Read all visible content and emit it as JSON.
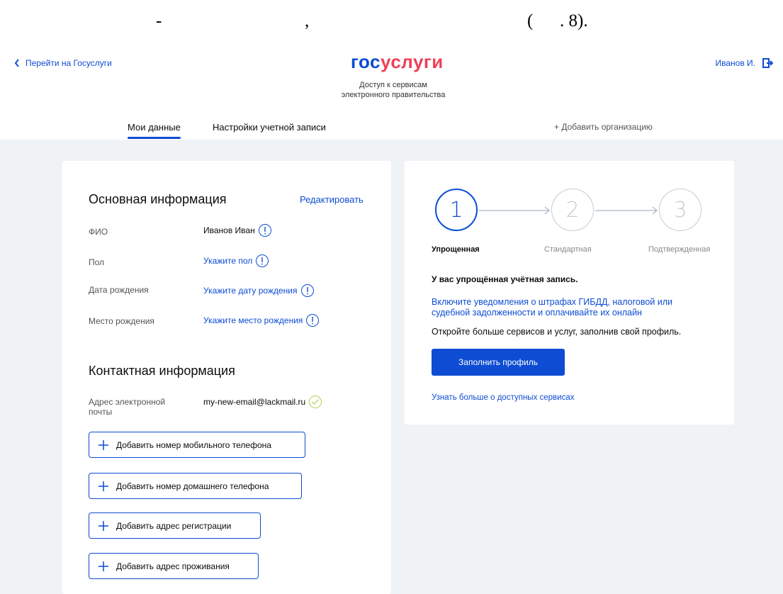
{
  "caption": {
    "dash": "-",
    "comma": ",",
    "open_paren": "(",
    "fig_ref": ". 8)."
  },
  "header": {
    "back_link": "Перейти на Госуслуги",
    "logo_gos": "гос",
    "logo_uslugi": "услуги",
    "tagline_line1": "Доступ к сервисам",
    "tagline_line2": "электронного правительства",
    "user_name": "Иванов И."
  },
  "tabs": {
    "my_data": "Мои данные",
    "account_settings": "Настройки учетной записи",
    "add_org": "+ Добавить организацию"
  },
  "basic_info": {
    "title": "Основная информация",
    "edit": "Редактировать",
    "rows": [
      {
        "label": "ФИО",
        "value": "Иванов Иван"
      },
      {
        "label": "Пол",
        "value": "Укажите пол"
      },
      {
        "label": "Дата рождения",
        "value": "Укажите дату рождения"
      },
      {
        "label": "Место рождения",
        "value": "Укажите место рождения"
      }
    ]
  },
  "contact_info": {
    "title": "Контактная информация",
    "email_label_line1": "Адрес электронной",
    "email_label_line2": "почты",
    "email_value": "my-new-email@lackmail.ru",
    "buttons": {
      "mobile": "Добавить номер мобильного телефона",
      "home": "Добавить номер домашнего телефона",
      "registration": "Добавить адрес регистрации",
      "residence": "Добавить адрес проживания"
    }
  },
  "account_level": {
    "steps": [
      {
        "number": "1",
        "label": "Упрощенная"
      },
      {
        "number": "2",
        "label": "Стандартная"
      },
      {
        "number": "3",
        "label": "Подтвержденная"
      }
    ],
    "status": "У вас упрощённая учётная запись.",
    "notify_line1": "Включите уведомления о штрафах ГИБДД, налоговой или",
    "notify_line2": "судебной задолженности и оплачивайте их онлайн",
    "open_more": "Откройте больше сервисов и услуг, заполнив свой профиль.",
    "fill_button": "Заполнить профиль",
    "more_link": "Узнать больше о доступных сервисах"
  },
  "colors": {
    "primary": "#0d4cd3",
    "logo_red": "#ee3f58",
    "success": "#b8d86d",
    "background": "#f0f3f6"
  },
  "icons": [
    "chevron-left-icon",
    "logout-icon",
    "info-icon",
    "check-icon",
    "plus-icon",
    "arrow-right-icon"
  ]
}
